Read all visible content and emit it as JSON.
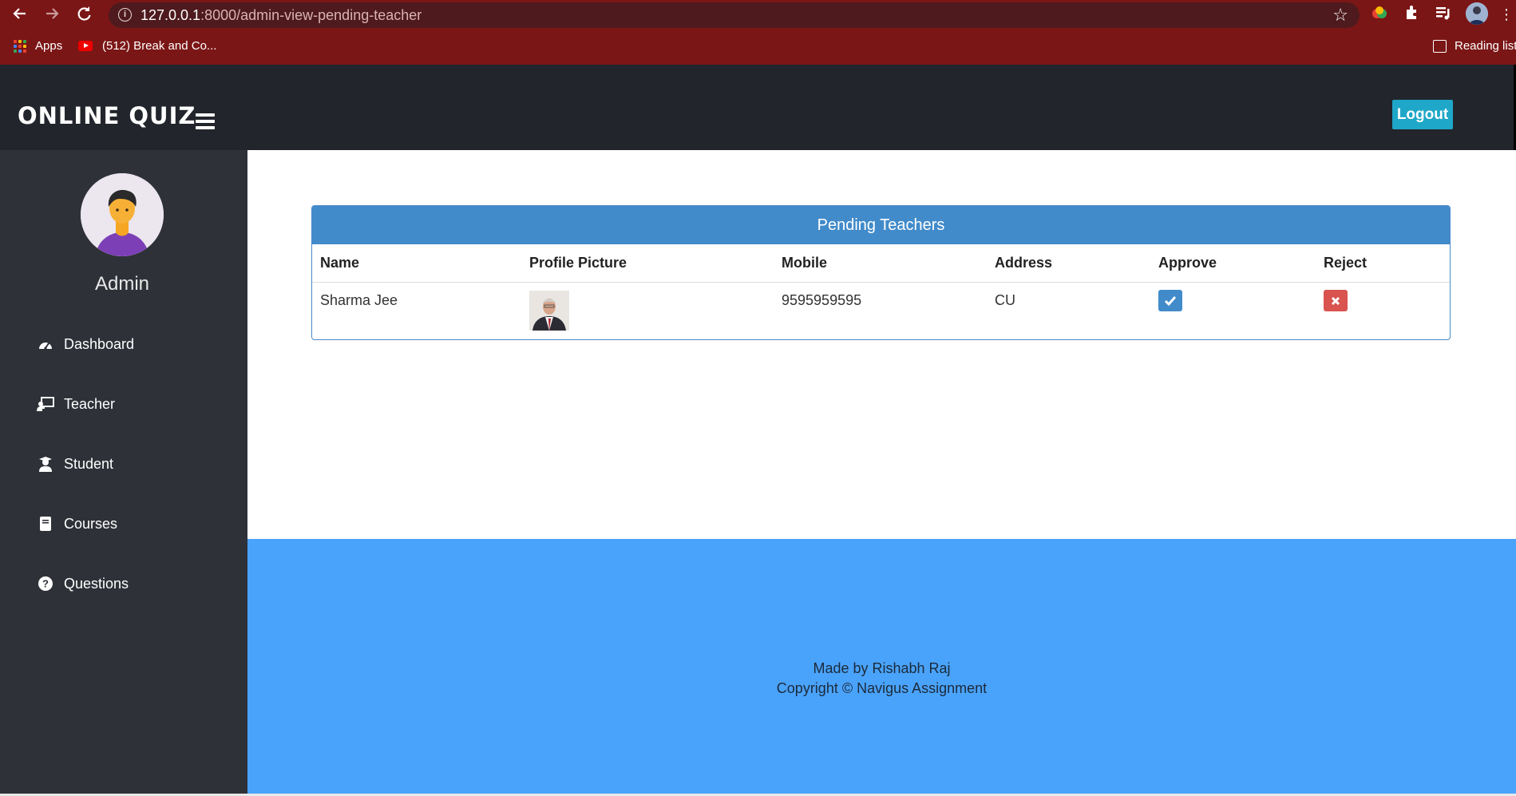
{
  "browser": {
    "url_host": "127.0.0.1",
    "url_path": ":8000/admin-view-pending-teacher",
    "bookmarks": {
      "apps": "Apps",
      "youtube": "(512) Break and Co...",
      "reading_list": "Reading list"
    },
    "icons": [
      "back-arrow-icon",
      "forward-arrow-icon",
      "reload-icon",
      "site-info-icon",
      "star-icon",
      "extensions-icon",
      "media-queue-icon",
      "profile-avatar-icon"
    ]
  },
  "header": {
    "brand": "ONLINE QUIZ",
    "logout_label": "Logout"
  },
  "sidebar": {
    "user_name": "Admin",
    "items": [
      {
        "label": "Dashboard",
        "icon": "dashboard-icon"
      },
      {
        "label": "Teacher",
        "icon": "teacher-icon"
      },
      {
        "label": "Student",
        "icon": "student-icon"
      },
      {
        "label": "Courses",
        "icon": "book-icon"
      },
      {
        "label": "Questions",
        "icon": "question-circle-icon"
      }
    ]
  },
  "panel": {
    "title": "Pending Teachers",
    "columns": [
      "Name",
      "Profile Picture",
      "Mobile",
      "Address",
      "Approve",
      "Reject"
    ],
    "rows": [
      {
        "name": "Sharma Jee",
        "mobile": "9595959595",
        "address": "CU"
      }
    ]
  },
  "footer": {
    "line1": "Made by Rishabh Raj",
    "line2": "Copyright © Navigus Assignment"
  },
  "colors": {
    "browser_frame": "#7b1616",
    "topbar": "#22252b",
    "sidebar": "#2e3138",
    "panel_header": "#428bca",
    "logout_button": "#1ea7c8",
    "approve_button": "#428bca",
    "reject_button": "#d9534f",
    "footer": "#4aa3fb"
  }
}
